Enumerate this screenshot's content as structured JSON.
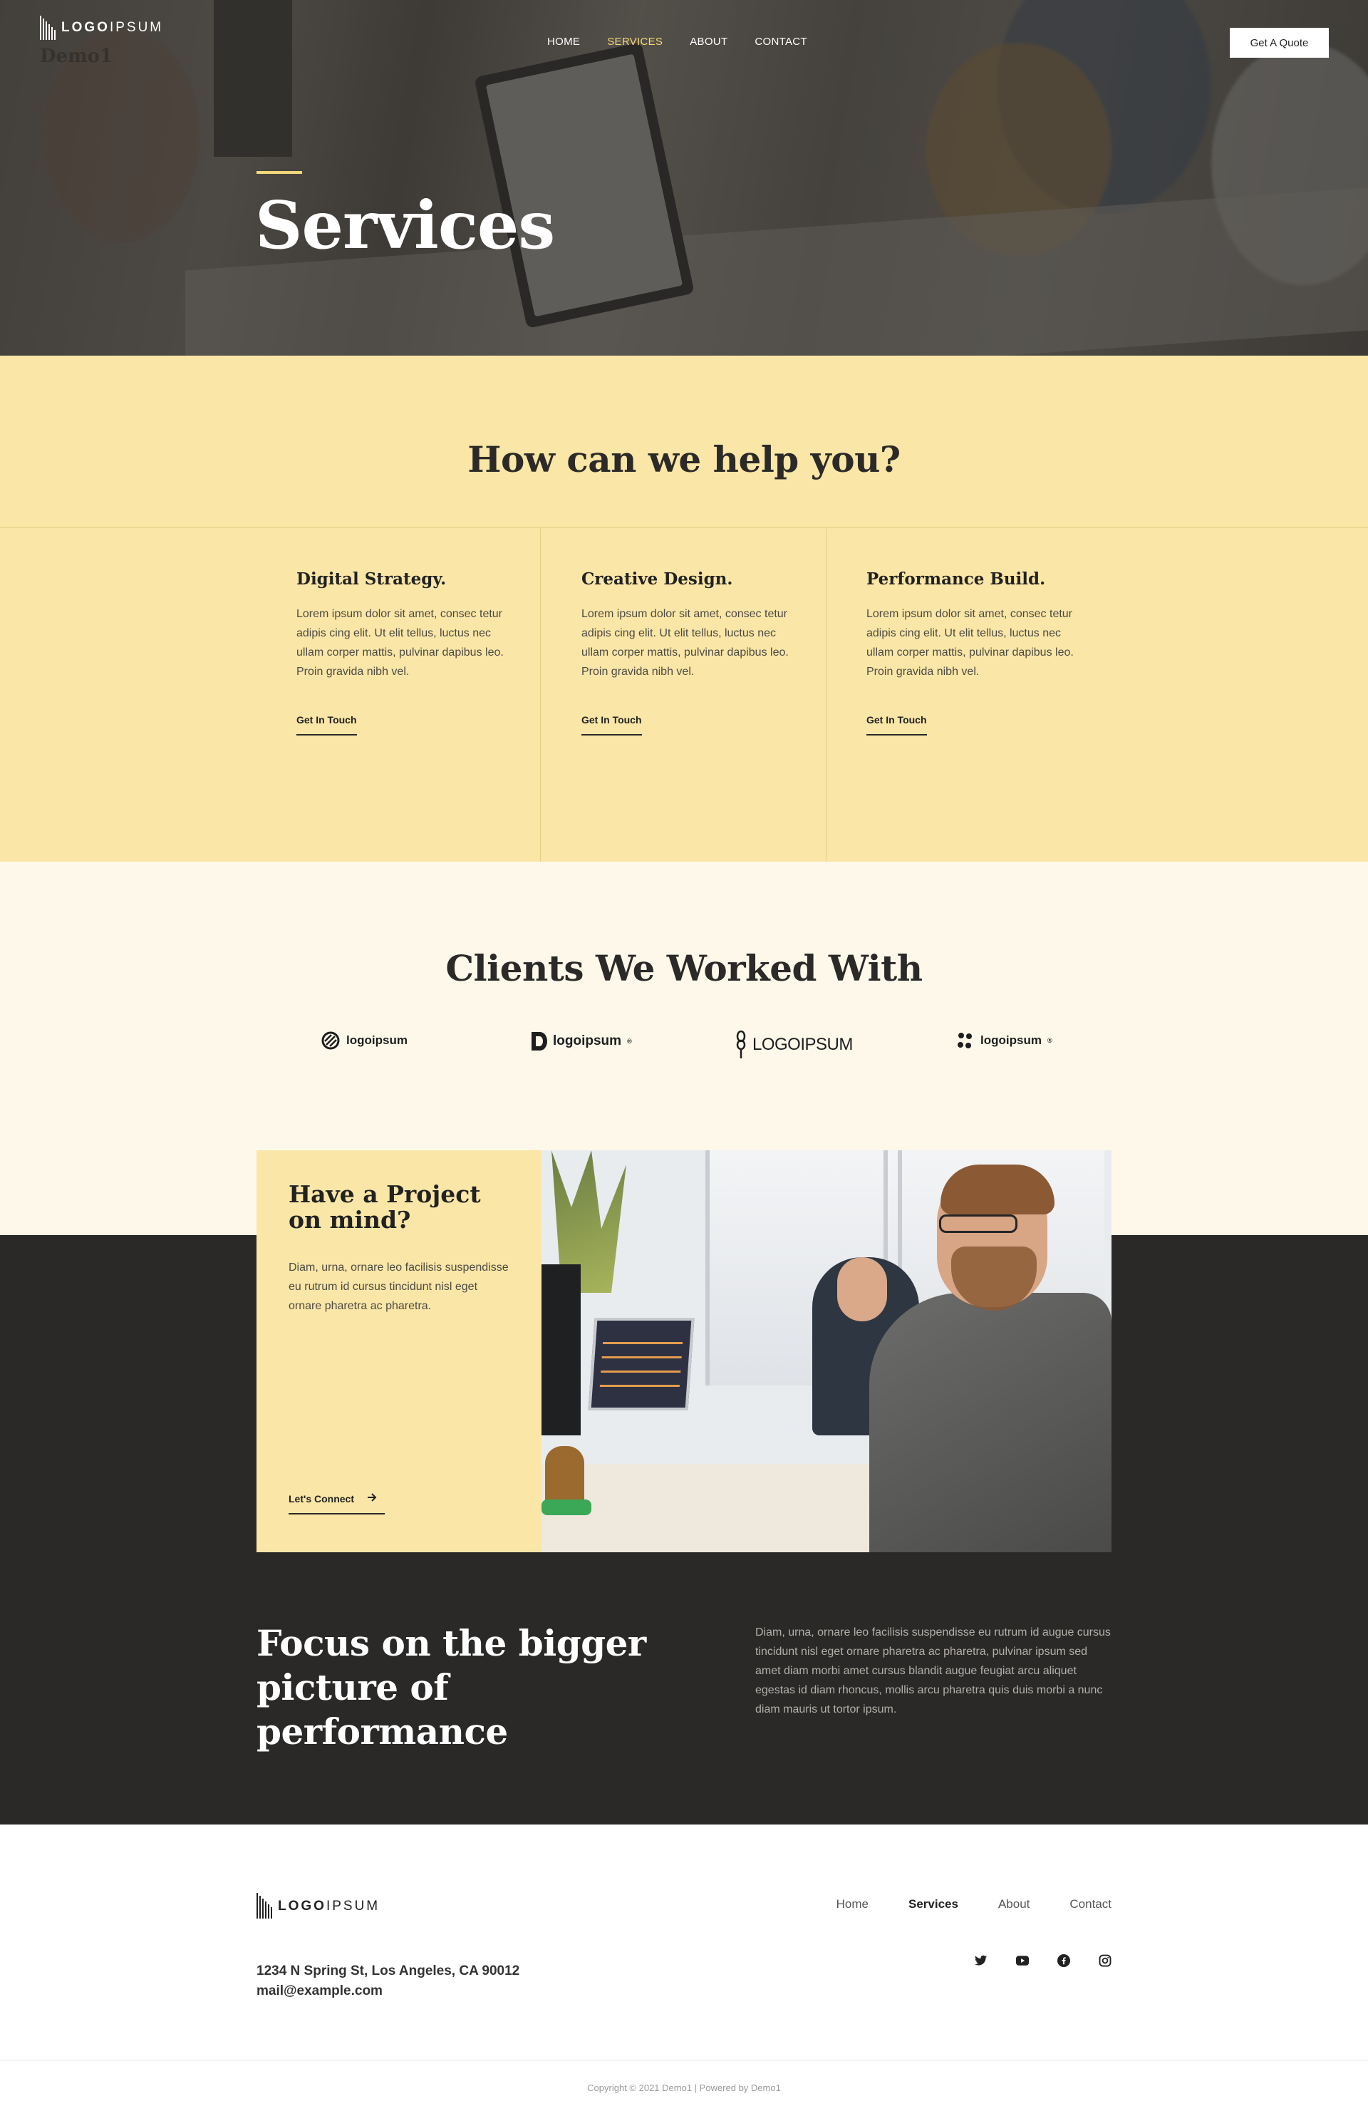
{
  "brand": {
    "logo_prefix": "LOGO",
    "logo_suffix": "IPSUM",
    "sub": "Demo1"
  },
  "nav": {
    "items": [
      {
        "label": "HOME",
        "active": false
      },
      {
        "label": "SERVICES",
        "active": true
      },
      {
        "label": "ABOUT",
        "active": false
      },
      {
        "label": "CONTACT",
        "active": false
      }
    ],
    "quote_button": "Get A Quote"
  },
  "hero": {
    "title": "Services"
  },
  "help": {
    "title": "How can we help you?",
    "cards": [
      {
        "title": "Digital Strategy.",
        "text": "Lorem ipsum dolor sit amet, consec tetur adipis cing elit. Ut elit tellus, luctus nec ullam corper mattis, pulvinar dapibus leo. Proin gravida nibh vel.",
        "cta": "Get In Touch"
      },
      {
        "title": "Creative Design.",
        "text": "Lorem ipsum dolor sit amet, consec tetur adipis cing elit. Ut elit tellus, luctus nec ullam corper mattis, pulvinar dapibus leo. Proin gravida nibh vel.",
        "cta": "Get In Touch"
      },
      {
        "title": "Performance Build.",
        "text": "Lorem ipsum dolor sit amet, consec tetur adipis cing elit. Ut elit tellus, luctus nec ullam corper mattis, pulvinar dapibus leo. Proin gravida nibh vel.",
        "cta": "Get In Touch"
      }
    ]
  },
  "clients": {
    "title": "Clients We Worked With",
    "logos": [
      "logoipsum",
      "logoipsum",
      "LOGOIPSUM",
      "logoipsum"
    ]
  },
  "project": {
    "title": "Have a Project on mind?",
    "text": "Diam, urna, ornare leo facilisis suspendisse eu rutrum id cursus tincidunt nisl eget ornare pharetra ac pharetra.",
    "cta": "Let's Connect"
  },
  "focus": {
    "title": "Focus on the bigger picture of performance",
    "text": "Diam, urna, ornare leo facilisis suspendisse eu rutrum id augue cursus tincidunt nisl eget ornare pharetra ac pharetra, pulvinar ipsum sed amet diam morbi amet cursus blandit augue feugiat arcu aliquet egestas id diam rhoncus, mollis arcu pharetra quis duis morbi a nunc diam mauris ut tortor ipsum."
  },
  "footer": {
    "nav": [
      {
        "label": "Home",
        "active": false
      },
      {
        "label": "Services",
        "active": true
      },
      {
        "label": "About",
        "active": false
      },
      {
        "label": "Contact",
        "active": false
      }
    ],
    "address": "1234 N Spring St, Los Angeles, CA 90012",
    "email": "mail@example.com",
    "social": [
      "twitter-icon",
      "youtube-icon",
      "facebook-icon",
      "instagram-icon"
    ],
    "copyright": "Copyright © 2021 Demo1 | Powered by Demo1"
  },
  "colors": {
    "accent": "#f5d77a",
    "yellow_bg": "#fae6a6",
    "cream_bg": "#fdf8ea",
    "dark_bg": "#2a2928"
  }
}
